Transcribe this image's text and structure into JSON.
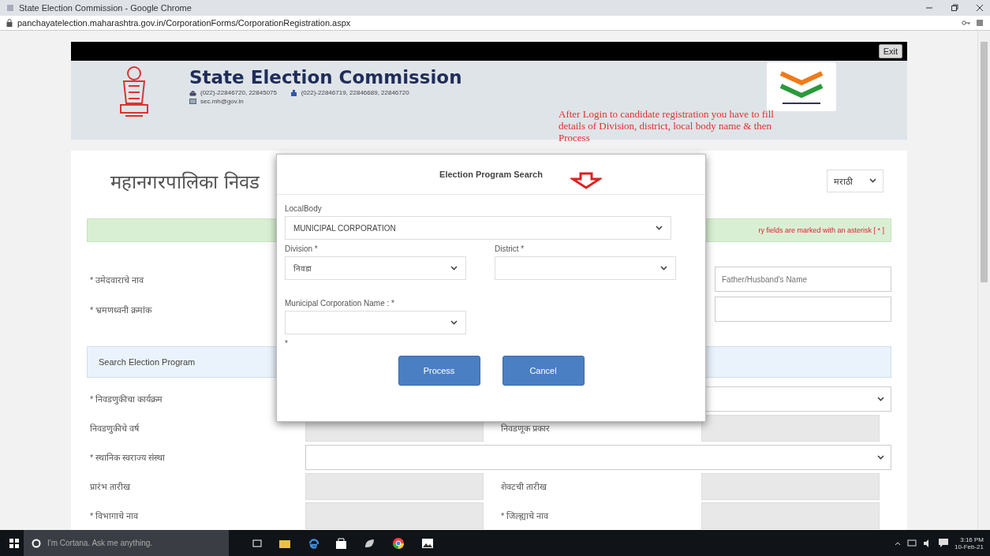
{
  "window": {
    "title": "State Election Commission - Google Chrome"
  },
  "address_bar": {
    "url": "panchayatelection.maharashtra.gov.in/CorporationForms/CorporationRegistration.aspx"
  },
  "header": {
    "exit_button": "Exit",
    "title": "State Election Commission",
    "phone": "(022)-22846720, 22845075",
    "fax": "(022)-22846719, 22846689, 22846720",
    "email": "sec.mh@gov.in"
  },
  "annotation": {
    "text": "After Login to candidate registration you have to fill details of Division, district, local body name & then Process"
  },
  "form": {
    "heading": "महानगरपालिका निवड",
    "language": "मराठी",
    "notice": "ry fields are marked with an asterisk [ * ]",
    "top_rows": [
      {
        "label": "* उमेदवाराचे नाव",
        "placeholder": "Father/Husband's Name"
      },
      {
        "label": "* भ्रमणध्वनी क्रमांक",
        "placeholder": ""
      }
    ],
    "section_title": "Search Election Program",
    "rows": [
      {
        "kind": "select",
        "labels": [
          "* निवडणुकीचा कार्यक्रम"
        ]
      },
      {
        "kind": "pair",
        "labels": [
          "निवडणुकीचे वर्ष",
          "निवडणूक प्रकार"
        ]
      },
      {
        "kind": "select",
        "labels": [
          "* स्थानिक स्वराज्य संस्था"
        ]
      },
      {
        "kind": "pair",
        "labels": [
          "प्रारंभ तारीख",
          "शेवटची तारीख"
        ]
      },
      {
        "kind": "pair",
        "labels": [
          "* विभागाचे नाव",
          "* जिल्ह्याचे नाव"
        ]
      }
    ]
  },
  "dialog": {
    "title": "Election Program Search",
    "localbody_label": "LocalBody",
    "localbody_value": "MUNICIPAL CORPORATION",
    "division_label": "Division *",
    "division_value": "निवडा",
    "district_label": "District *",
    "corporation_label": "Municipal Corporation Name : *",
    "note": "*",
    "buttons": [
      "Process",
      "Cancel"
    ]
  },
  "taskbar": {
    "search_placeholder": "I'm Cortana. Ask me anything.",
    "time": "3:16 PM",
    "date": "10-Feb-21"
  }
}
